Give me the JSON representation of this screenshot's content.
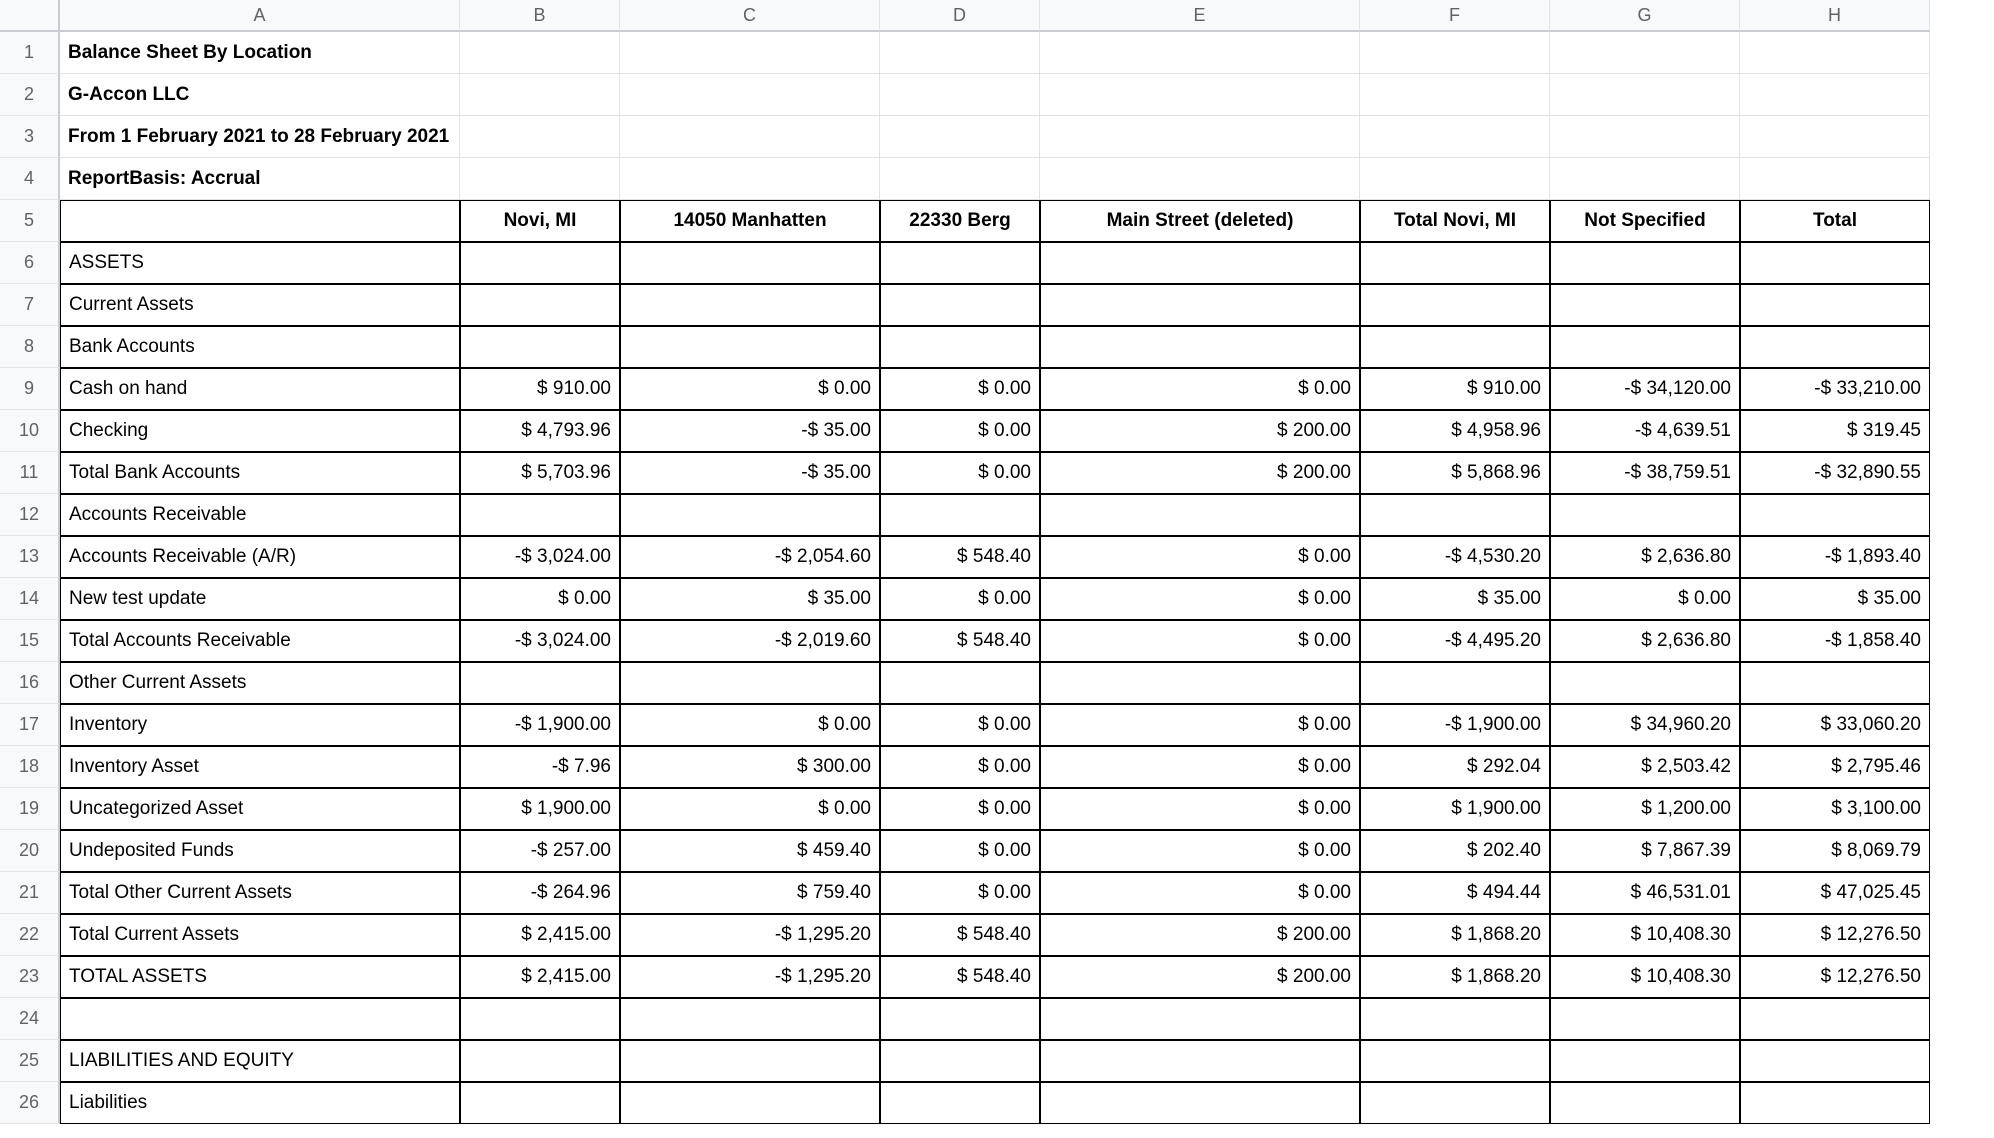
{
  "columnHeaders": [
    "A",
    "B",
    "C",
    "D",
    "E",
    "F",
    "G",
    "H"
  ],
  "title": "Balance Sheet By Location",
  "company": "G-Accon LLC",
  "period": "From 1 February 2021 to 28 February 2021",
  "basis": "ReportBasis: Accrual",
  "columns": {
    "b": "Novi, MI",
    "c": "14050 Manhatten",
    "d": "22330 Berg",
    "e": "Main Street (deleted)",
    "f": "Total Novi, MI",
    "g": "Not Specified",
    "h": "Total"
  },
  "rows": [
    {
      "n": 6,
      "label": "ASSETS"
    },
    {
      "n": 7,
      "label": "Current Assets"
    },
    {
      "n": 8,
      "label": "Bank Accounts"
    },
    {
      "n": 9,
      "label": "Cash on hand",
      "b": "$ 910.00",
      "c": "$ 0.00",
      "d": "$ 0.00",
      "e": "$ 0.00",
      "f": "$ 910.00",
      "g": "-$ 34,120.00",
      "h": "-$ 33,210.00"
    },
    {
      "n": 10,
      "label": "Checking",
      "b": "$ 4,793.96",
      "c": "-$ 35.00",
      "d": "$ 0.00",
      "e": "$ 200.00",
      "f": "$ 4,958.96",
      "g": "-$ 4,639.51",
      "h": "$ 319.45"
    },
    {
      "n": 11,
      "label": "Total Bank Accounts",
      "b": "$ 5,703.96",
      "c": "-$ 35.00",
      "d": "$ 0.00",
      "e": "$ 200.00",
      "f": "$ 5,868.96",
      "g": "-$ 38,759.51",
      "h": "-$ 32,890.55"
    },
    {
      "n": 12,
      "label": "Accounts Receivable"
    },
    {
      "n": 13,
      "label": "Accounts Receivable (A/R)",
      "b": "-$ 3,024.00",
      "c": "-$ 2,054.60",
      "d": "$ 548.40",
      "e": "$ 0.00",
      "f": "-$ 4,530.20",
      "g": "$ 2,636.80",
      "h": "-$ 1,893.40"
    },
    {
      "n": 14,
      "label": "New test update",
      "b": "$ 0.00",
      "c": "$ 35.00",
      "d": "$ 0.00",
      "e": "$ 0.00",
      "f": "$ 35.00",
      "g": "$ 0.00",
      "h": "$ 35.00"
    },
    {
      "n": 15,
      "label": "Total Accounts Receivable",
      "b": "-$ 3,024.00",
      "c": "-$ 2,019.60",
      "d": "$ 548.40",
      "e": "$ 0.00",
      "f": "-$ 4,495.20",
      "g": "$ 2,636.80",
      "h": "-$ 1,858.40"
    },
    {
      "n": 16,
      "label": "Other Current Assets"
    },
    {
      "n": 17,
      "label": "Inventory",
      "b": "-$ 1,900.00",
      "c": "$ 0.00",
      "d": "$ 0.00",
      "e": "$ 0.00",
      "f": "-$ 1,900.00",
      "g": "$ 34,960.20",
      "h": "$ 33,060.20"
    },
    {
      "n": 18,
      "label": "Inventory Asset",
      "b": "-$ 7.96",
      "c": "$ 300.00",
      "d": "$ 0.00",
      "e": "$ 0.00",
      "f": "$ 292.04",
      "g": "$ 2,503.42",
      "h": "$ 2,795.46"
    },
    {
      "n": 19,
      "label": "Uncategorized Asset",
      "b": "$ 1,900.00",
      "c": "$ 0.00",
      "d": "$ 0.00",
      "e": "$ 0.00",
      "f": "$ 1,900.00",
      "g": "$ 1,200.00",
      "h": "$ 3,100.00"
    },
    {
      "n": 20,
      "label": "Undeposited Funds",
      "b": "-$ 257.00",
      "c": "$ 459.40",
      "d": "$ 0.00",
      "e": "$ 0.00",
      "f": "$ 202.40",
      "g": "$ 7,867.39",
      "h": "$ 8,069.79"
    },
    {
      "n": 21,
      "label": "Total Other Current Assets",
      "b": "-$ 264.96",
      "c": "$ 759.40",
      "d": "$ 0.00",
      "e": "$ 0.00",
      "f": "$ 494.44",
      "g": "$ 46,531.01",
      "h": "$ 47,025.45"
    },
    {
      "n": 22,
      "label": "Total Current Assets",
      "b": "$ 2,415.00",
      "c": "-$ 1,295.20",
      "d": "$ 548.40",
      "e": "$ 200.00",
      "f": "$ 1,868.20",
      "g": "$ 10,408.30",
      "h": "$ 12,276.50"
    },
    {
      "n": 23,
      "label": "TOTAL ASSETS",
      "b": "$ 2,415.00",
      "c": "-$ 1,295.20",
      "d": "$ 548.40",
      "e": "$ 200.00",
      "f": "$ 1,868.20",
      "g": "$ 10,408.30",
      "h": "$ 12,276.50"
    },
    {
      "n": 24,
      "label": ""
    },
    {
      "n": 25,
      "label": "LIABILITIES AND EQUITY"
    },
    {
      "n": 26,
      "label": "Liabilities"
    }
  ]
}
